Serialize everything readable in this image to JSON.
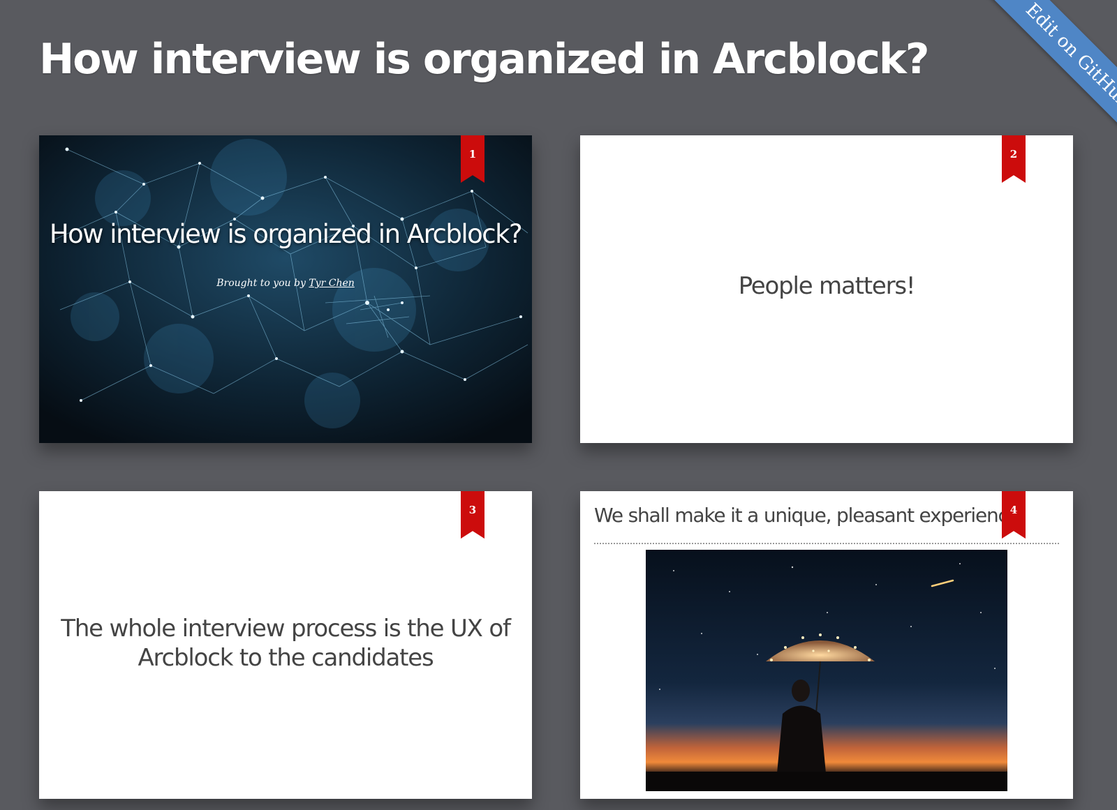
{
  "header": {
    "title": "How interview is organized in Arcblock?"
  },
  "ribbon": {
    "label": "Edit on GitHub"
  },
  "slides": [
    {
      "number": "1",
      "title": "How interview is organized in Arcblock?",
      "subtitle_prefix": "Brought to you by ",
      "author": "Tyr Chen"
    },
    {
      "number": "2",
      "text": "People matters!"
    },
    {
      "number": "3",
      "text": "The whole interview process is the UX of Arcblock to the candidates"
    },
    {
      "number": "4",
      "title": "We shall make it a unique, pleasant experience!"
    }
  ],
  "colors": {
    "background": "#595a5f",
    "ribbon": "#4f86c6",
    "bookmark": "#cc0c0c"
  },
  "icons": {
    "slide_marker": "bookmark-icon"
  }
}
